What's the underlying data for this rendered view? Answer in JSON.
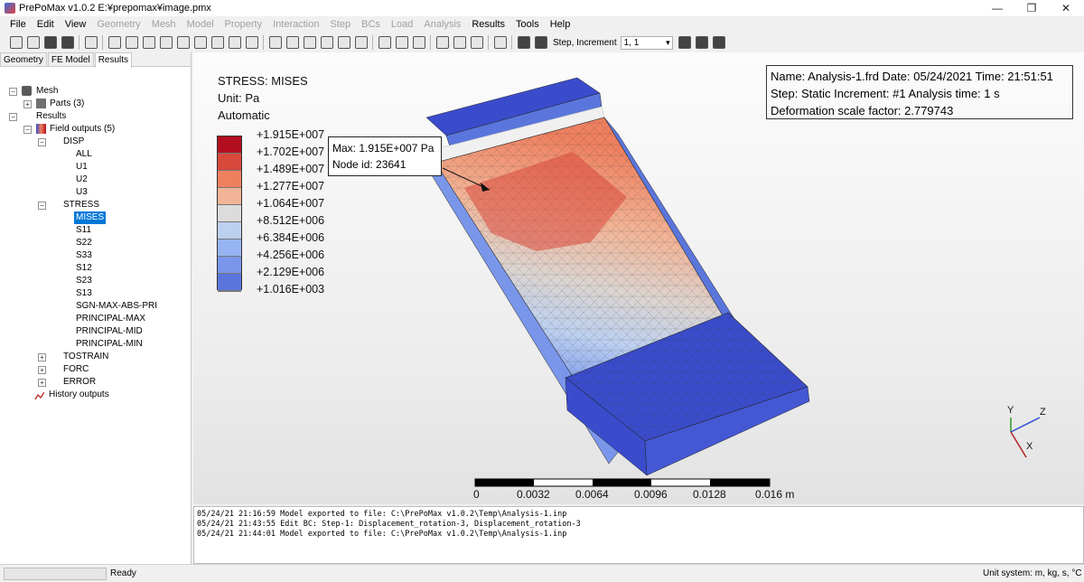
{
  "window": {
    "title": "PrePoMax v1.0.2   E:¥prepomax¥image.pmx",
    "minimize": "—",
    "maximize": "❐",
    "close": "✕"
  },
  "menu": [
    {
      "label": "File",
      "enabled": true
    },
    {
      "label": "Edit",
      "enabled": true
    },
    {
      "label": "View",
      "enabled": true
    },
    {
      "label": "Geometry",
      "enabled": false
    },
    {
      "label": "Mesh",
      "enabled": false
    },
    {
      "label": "Model",
      "enabled": false
    },
    {
      "label": "Property",
      "enabled": false
    },
    {
      "label": "Interaction",
      "enabled": false
    },
    {
      "label": "Step",
      "enabled": false
    },
    {
      "label": "BCs",
      "enabled": false
    },
    {
      "label": "Load",
      "enabled": false
    },
    {
      "label": "Analysis",
      "enabled": false
    },
    {
      "label": "Results",
      "enabled": true
    },
    {
      "label": "Tools",
      "enabled": true
    },
    {
      "label": "Help",
      "enabled": true
    }
  ],
  "toolbar": {
    "step_increment_label": "Step, Increment",
    "step_increment_value": "1, 1"
  },
  "tabs": [
    "Geometry",
    "FE Model",
    "Results"
  ],
  "active_tab": "Results",
  "tree": {
    "mesh": "Mesh",
    "parts": "Parts (3)",
    "results": "Results",
    "field_outputs": "Field outputs (5)",
    "disp": "DISP",
    "disp_items": [
      "ALL",
      "U1",
      "U2",
      "U3"
    ],
    "stress": "STRESS",
    "stress_items": [
      "MISES",
      "S11",
      "S22",
      "S33",
      "S12",
      "S23",
      "S13",
      "SGN-MAX-ABS-PRI",
      "PRINCIPAL-MAX",
      "PRINCIPAL-MID",
      "PRINCIPAL-MIN"
    ],
    "selected": "MISES",
    "tostrain": "TOSTRAIN",
    "forc": "FORC",
    "error": "ERROR",
    "history_outputs": "History outputs"
  },
  "viewport": {
    "legend": {
      "title": "STRESS: MISES",
      "unit": "Unit: Pa",
      "mode": "Automatic",
      "values": [
        "+1.915E+007",
        "+1.702E+007",
        "+1.489E+007",
        "+1.277E+007",
        "+1.064E+007",
        "+8.512E+006",
        "+6.384E+006",
        "+4.256E+006",
        "+2.129E+006",
        "+1.016E+003"
      ],
      "colors": [
        "#b40f20",
        "#d8493c",
        "#ee8060",
        "#f2b496",
        "#dcdcdc",
        "#bcd0f0",
        "#96b4f2",
        "#7a96ea",
        "#5a76dc",
        "#3a4ccc"
      ]
    },
    "info": {
      "line1": "Name: Analysis-1.frd   Date: 05/24/2021   Time: 21:51:51",
      "line2": "Step: Static   Increment: #1   Analysis time: 1 s",
      "line3": "Deformation scale factor: 2.779743"
    },
    "max_tooltip": {
      "line1": "Max: 1.915E+007 Pa",
      "line2": "Node id: 23641"
    },
    "scale_bar": {
      "labels": [
        "0",
        "0.0032",
        "0.0064",
        "0.0096",
        "0.0128",
        "0.016 m"
      ]
    },
    "axes": {
      "x": "X",
      "y": "Y",
      "z": "Z"
    }
  },
  "console": {
    "lines": [
      "05/24/21 21:16:59   Model exported to file: C:\\PrePoMax v1.0.2\\Temp\\Analysis-1.inp",
      "05/24/21 21:43:55   Edit BC: Step-1: Displacement_rotation-3, Displacement_rotation-3",
      "05/24/21 21:44:01   Model exported to file: C:\\PrePoMax v1.0.2\\Temp\\Analysis-1.inp"
    ]
  },
  "status": {
    "text": "Ready",
    "unit_system": "Unit system: m, kg, s, °C"
  }
}
